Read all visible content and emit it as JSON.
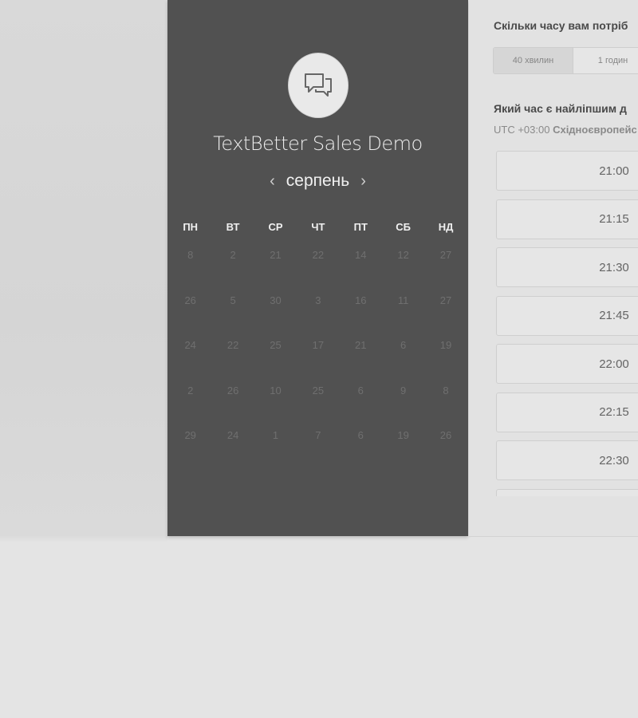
{
  "brand": {
    "title": "TextBetter Sales Demo",
    "logo_icon": "chat-bubbles-icon"
  },
  "calendar": {
    "month": "серпень",
    "prev_icon": "chevron-left-icon",
    "next_icon": "chevron-right-icon",
    "weekdays": [
      "ПН",
      "ВТ",
      "СР",
      "ЧТ",
      "ПТ",
      "СБ",
      "НД"
    ],
    "weeks": [
      [
        "8",
        "2",
        "21",
        "22",
        "14",
        "12",
        "27"
      ],
      [
        "26",
        "5",
        "30",
        "3",
        "16",
        "11",
        "27"
      ],
      [
        "24",
        "22",
        "25",
        "17",
        "21",
        "6",
        "19"
      ],
      [
        "2",
        "26",
        "10",
        "25",
        "6",
        "9",
        "8"
      ],
      [
        "29",
        "24",
        "1",
        "7",
        "6",
        "19",
        "26"
      ]
    ]
  },
  "duration": {
    "question": "Скільки часу вам потріб",
    "options": [
      "40 хвилин",
      "1 годин"
    ]
  },
  "time": {
    "question": "Який час є найліпшим д",
    "tz_prefix": "UTC +03:00",
    "tz_name": "Східноєвропейс",
    "slots": [
      "21:00",
      "21:15",
      "21:30",
      "21:45",
      "22:00",
      "22:15",
      "22:30",
      ""
    ]
  },
  "colors": {
    "left_panel": "#515151",
    "right_panel": "#e2e2e2",
    "page_bg": "#e4e4e4"
  }
}
